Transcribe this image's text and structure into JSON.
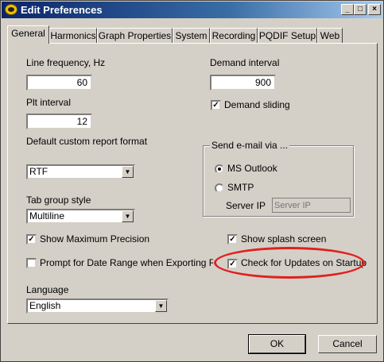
{
  "window": {
    "title": "Edit Preferences",
    "controls": {
      "minimize": "_",
      "maximize": "□",
      "close": "×"
    }
  },
  "tabs": [
    "General",
    "Harmonics",
    "Graph Properties",
    "System",
    "Recording",
    "PQDIF Setup",
    "Web"
  ],
  "active_tab": "General",
  "general": {
    "line_frequency": {
      "label": "Line frequency, Hz",
      "value": "60"
    },
    "plt_interval": {
      "label": "Plt interval",
      "value": "12"
    },
    "report_format": {
      "label": "Default custom report format",
      "value": "RTF"
    },
    "tab_group_style": {
      "label": "Tab group style",
      "value": "Multiline"
    },
    "show_max_precision": {
      "label": "Show Maximum Precision",
      "checked": true
    },
    "prompt_date_range": {
      "label": "Prompt for Date Range when Exporting Report",
      "checked": false
    },
    "language": {
      "label": "Language",
      "value": "English"
    },
    "demand_interval": {
      "label": "Demand interval",
      "value": "900"
    },
    "demand_sliding": {
      "label": "Demand sliding",
      "checked": true
    },
    "email": {
      "legend": "Send e-mail via ...",
      "ms_outlook": {
        "label": "MS Outlook",
        "selected": true
      },
      "smtp": {
        "label": "SMTP",
        "selected": false
      },
      "server_ip": {
        "label": "Server IP",
        "placeholder": "Server IP"
      }
    },
    "show_splash": {
      "label": "Show splash screen",
      "checked": true
    },
    "check_updates": {
      "label": "Check for Updates on Startup",
      "checked": true
    }
  },
  "buttons": {
    "ok": "OK",
    "cancel": "Cancel"
  },
  "annotation_color": "#e02020"
}
